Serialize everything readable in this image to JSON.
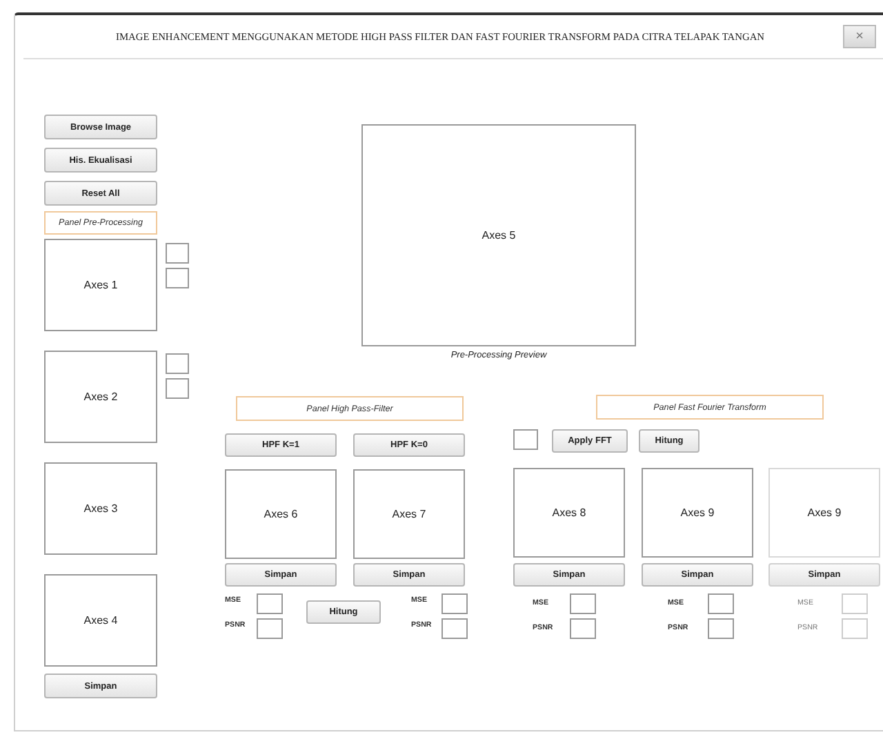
{
  "window": {
    "title": "IMAGE ENHANCEMENT MENGGUNAKAN METODE HIGH PASS FILTER DAN FAST FOURIER TRANSFORM PADA CITRA TELAPAK TANGAN",
    "close": "×"
  },
  "left_buttons": [
    "Browse Image",
    "His. Ekualisasi",
    "Reset All"
  ],
  "pre_panel": "Panel Pre-Processing",
  "left_axes": [
    "Axes 1",
    "Axes 2",
    "Axes 3",
    "Axes 4"
  ],
  "left_save": "Simpan",
  "preview": {
    "axes": "Axes 5",
    "caption": "Pre-Processing Preview"
  },
  "hpf": {
    "panel": "Panel High Pass-Filter",
    "hitung": "Hitung",
    "columns": [
      {
        "button": "HPF K=1",
        "axes": "Axes 6",
        "save": "Simpan",
        "mse": "MSE",
        "psnr": "PSNR"
      },
      {
        "button": "HPF K=0",
        "axes": "Axes 7",
        "save": "Simpan",
        "mse": "MSE",
        "psnr": "PSNR"
      }
    ]
  },
  "fft": {
    "panel": "Panel Fast Fourier Transform",
    "apply": "Apply FFT",
    "hitung": "Hitung",
    "columns": [
      {
        "axes": "Axes 8",
        "save": "Simpan",
        "mse": "MSE",
        "psnr": "PSNR",
        "disabled": false
      },
      {
        "axes": "Axes 9",
        "save": "Simpan",
        "mse": "MSE",
        "psnr": "PSNR",
        "disabled": false
      },
      {
        "axes": "Axes 9",
        "save": "Simpan",
        "mse": "MSE",
        "psnr": "PSNR",
        "disabled": true
      }
    ]
  }
}
